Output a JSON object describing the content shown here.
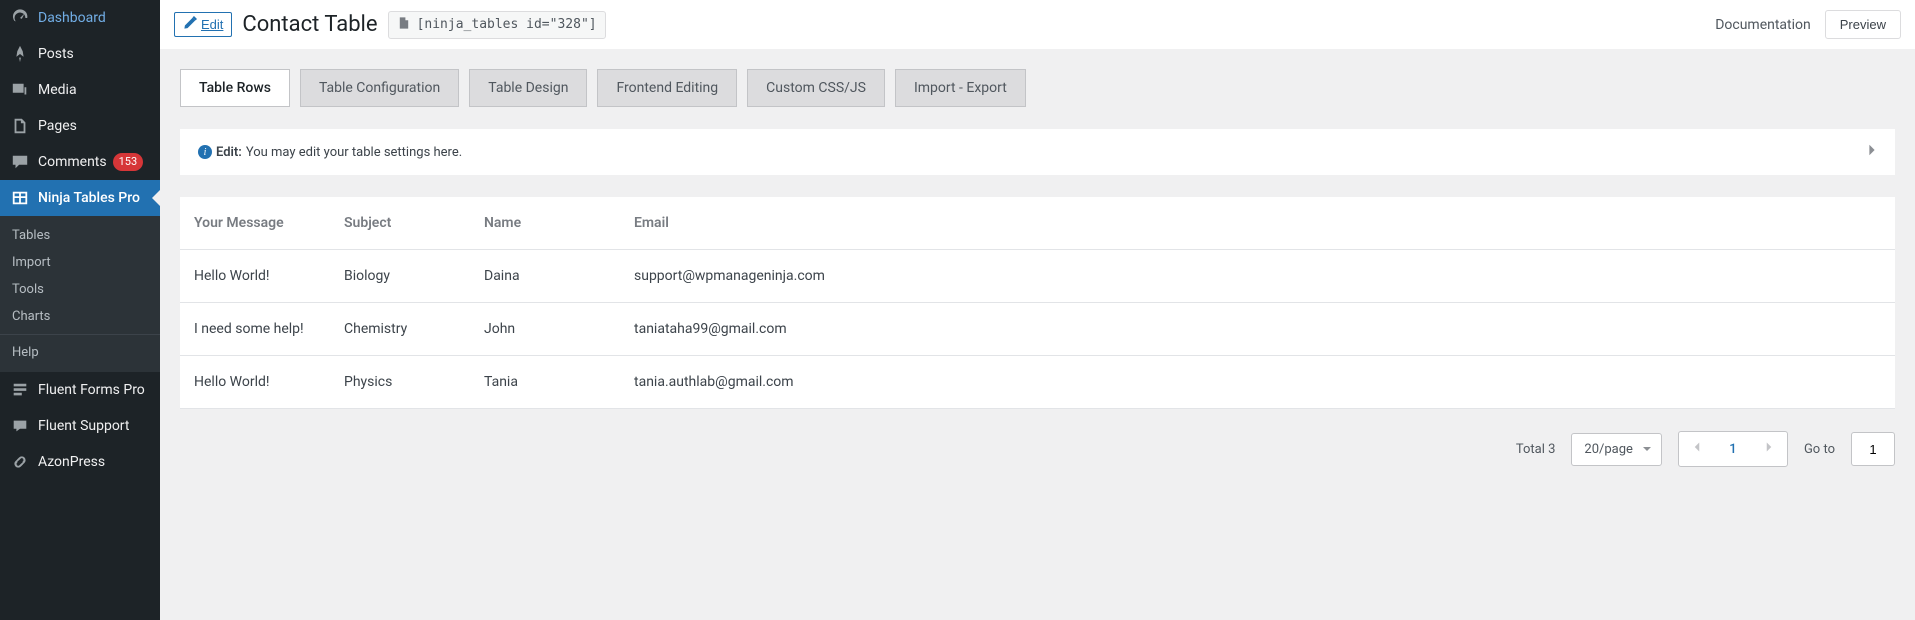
{
  "sidebar": {
    "items": [
      {
        "label": "Dashboard",
        "icon": "gauge"
      },
      {
        "label": "Posts",
        "icon": "pin"
      },
      {
        "label": "Media",
        "icon": "media"
      },
      {
        "label": "Pages",
        "icon": "page"
      },
      {
        "label": "Comments",
        "icon": "comment",
        "badge": "153"
      },
      {
        "label": "Ninja Tables Pro",
        "icon": "table",
        "active": true
      },
      {
        "label": "Fluent Forms Pro",
        "icon": "forms"
      },
      {
        "label": "Fluent Support",
        "icon": "support"
      },
      {
        "label": "AzonPress",
        "icon": "link"
      }
    ],
    "submenu": [
      "Tables",
      "Import",
      "Tools",
      "Charts",
      "Help"
    ]
  },
  "header": {
    "edit_label": "Edit",
    "title": "Contact Table",
    "shortcode": "[ninja_tables id=\"328\"]",
    "documentation_label": "Documentation",
    "preview_label": "Preview"
  },
  "tabs": [
    {
      "label": "Table Rows",
      "active": true
    },
    {
      "label": "Table Configuration"
    },
    {
      "label": "Table Design"
    },
    {
      "label": "Frontend Editing"
    },
    {
      "label": "Custom CSS/JS"
    },
    {
      "label": "Import - Export"
    }
  ],
  "info_panel": {
    "heading": "Edit:",
    "body": "You may edit your table settings here."
  },
  "table": {
    "columns": [
      "Your Message",
      "Subject",
      "Name",
      "Email"
    ],
    "rows": [
      {
        "message": "Hello World!",
        "subject": "Biology",
        "name": "Daina",
        "email": "support@wpmanageninja.com"
      },
      {
        "message": "I need some help!",
        "subject": "Chemistry",
        "name": "John",
        "email": "taniataha99@gmail.com"
      },
      {
        "message": "Hello World!",
        "subject": "Physics",
        "name": "Tania",
        "email": "tania.authlab@gmail.com"
      }
    ]
  },
  "pagination": {
    "total_label": "Total 3",
    "page_size_label": "20/page",
    "current_page": "1",
    "goto_label": "Go to",
    "goto_value": "1"
  }
}
